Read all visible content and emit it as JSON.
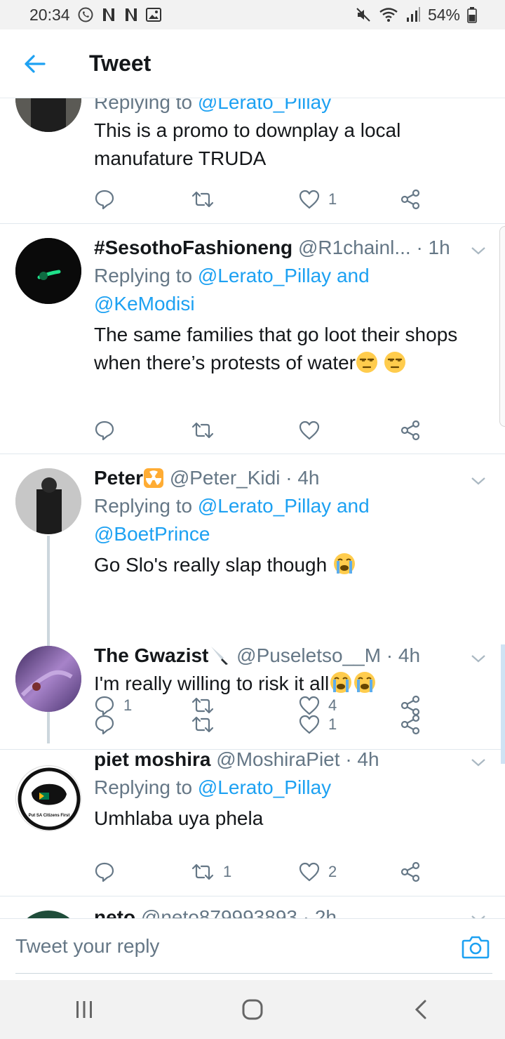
{
  "status_bar": {
    "time": "20:34",
    "notification_icons": [
      "whatsapp-icon",
      "netflix-icon",
      "netflix-icon",
      "gallery-icon"
    ],
    "system_icons": [
      "mute-icon",
      "wifi-icon",
      "signal-icon"
    ],
    "battery": "54%"
  },
  "header": {
    "title": "Tweet"
  },
  "tweets": [
    {
      "replying_prefix": "Replying to ",
      "mention1": "@Lerato_Pillay",
      "text": "This is a promo to downplay a local manufature TRUDA",
      "replies": "",
      "retweets": "",
      "likes": "1"
    },
    {
      "name": "#SesothoFashioneng",
      "handle": "@R1chainl...",
      "time": "· 1h",
      "replying_prefix": "Replying to ",
      "mention1": "@Lerato_Pillay and",
      "mention2": "@KeModisi",
      "text": "The same families that go loot their shops when there’s protests of water",
      "emoji": "unamused-face-emoji",
      "replies": "",
      "retweets": "",
      "likes": ""
    },
    {
      "name": "Peter",
      "name_emoji": "radioactive-emoji",
      "handle": "@Peter_Kidi",
      "time": "· 4h",
      "replying_prefix": "Replying to ",
      "mention1": "@Lerato_Pillay and",
      "mention2": "@BoetPrince",
      "text": "Go Slo's really slap though",
      "emoji": "crying-face-emoji",
      "replies": "1",
      "retweets": "",
      "likes": "4"
    },
    {
      "name": "The Gwazist",
      "name_emoji": "knife-emoji",
      "handle": "@Puseletso__M",
      "time": "· 4h",
      "text": "I'm really willing to risk it all",
      "emoji": "crying-face-emoji",
      "replies": "",
      "retweets": "",
      "likes": "1"
    },
    {
      "name": "piet moshira",
      "handle": "@MoshiraPiet",
      "time": "· 4h",
      "replying_prefix": "Replying to ",
      "mention1": "@Lerato_Pillay",
      "text": "Umhlaba uya phela",
      "avatar_text": "Put SA Citizens First",
      "replies": "",
      "retweets": "1",
      "likes": "2"
    },
    {
      "name": "neto",
      "handle": "@neto879993893",
      "time": "· 2h"
    }
  ],
  "reply_bar": {
    "placeholder": "Tweet your reply"
  },
  "colors": {
    "accent": "#1da1f2",
    "secondary_text": "#657786",
    "primary_text": "#14171a",
    "divider": "#e1e8ed"
  }
}
